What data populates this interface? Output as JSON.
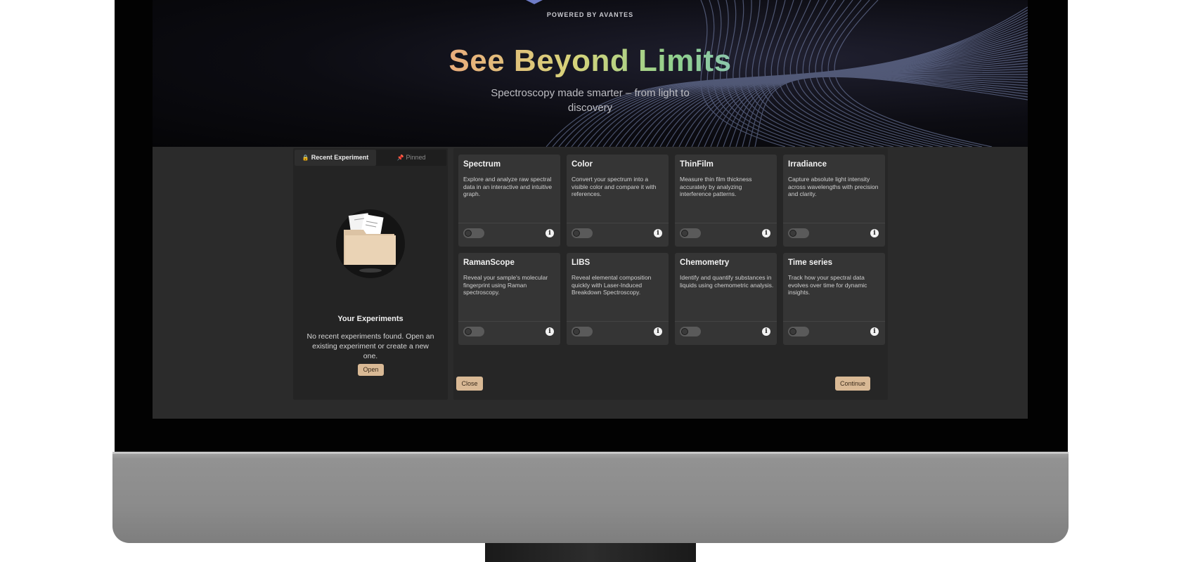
{
  "hero": {
    "powered_by": "POWERED BY AVANTES",
    "title": "See Beyond Limits",
    "subtitle": "Spectroscopy made smarter – from light to discovery"
  },
  "experiments_panel": {
    "tabs": [
      {
        "label": "Recent Experiment",
        "icon": "lock-icon",
        "active": true
      },
      {
        "label": "Pinned",
        "icon": "pin-icon",
        "active": false
      }
    ],
    "empty_icon": "folder-with-documents-icon",
    "heading": "Your Experiments",
    "message": "No recent experiments found. Open an existing experiment or create a new one.",
    "open_label": "Open"
  },
  "modules": [
    {
      "title": "Spectrum",
      "description": "Explore and analyze raw spectral data in an interactive and intuitive graph.",
      "enabled": false
    },
    {
      "title": "Color",
      "description": "Convert your spectrum into a visible color and compare it with references.",
      "enabled": false
    },
    {
      "title": "ThinFilm",
      "description": "Measure thin film thickness accurately by analyzing interference patterns.",
      "enabled": false
    },
    {
      "title": "Irradiance",
      "description": "Capture absolute light intensity across wavelengths with precision and clarity.",
      "enabled": false
    },
    {
      "title": "RamanScope",
      "description": "Reveal your sample's molecular fingerprint using Raman spectroscopy.",
      "enabled": false
    },
    {
      "title": "LIBS",
      "description": "Reveal elemental composition quickly with Laser-Induced Breakdown Spectroscopy.",
      "enabled": false
    },
    {
      "title": "Chemometry",
      "description": "Identify and quantify substances in liquids using chemometric analysis.",
      "enabled": false
    },
    {
      "title": "Time series",
      "description": "Track how your spectral data evolves over time for dynamic insights.",
      "enabled": false
    }
  ],
  "actions": {
    "close_label": "Close",
    "continue_label": "Continue"
  },
  "colors": {
    "accent_button": "#d9b995",
    "card_bg": "#353535",
    "panel_bg": "#262626"
  }
}
